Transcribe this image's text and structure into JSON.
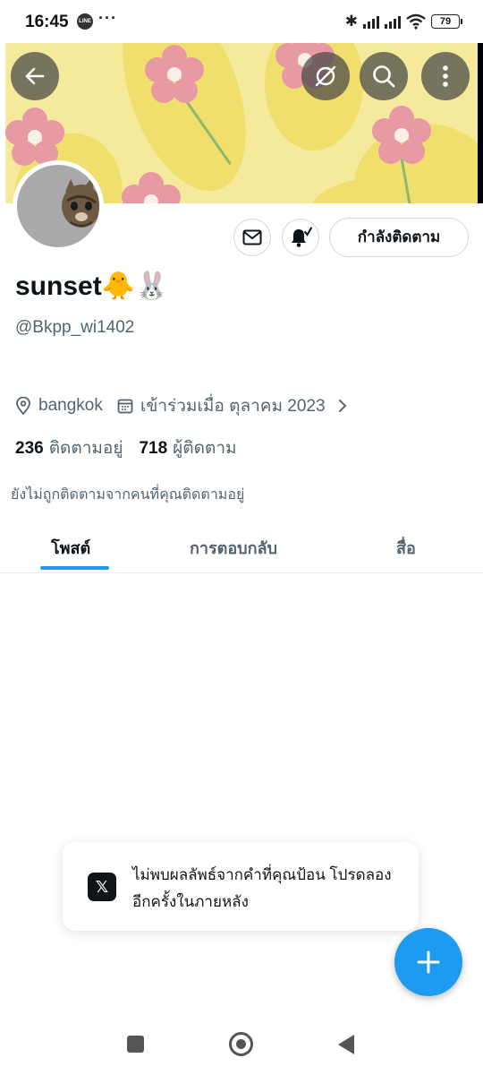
{
  "status_bar": {
    "time": "16:45",
    "line_app_label": "LINE",
    "more": "···",
    "bluetooth": "✱",
    "battery": "79"
  },
  "profile": {
    "name": "sunset🐥🐰",
    "handle": "@Bkpp_wi1402",
    "location": "bangkok",
    "joined": "เข้าร่วมเมื่อ ตุลาคม 2023",
    "following_count": "236",
    "following_label": "ติดตามอยู่",
    "followers_count": "718",
    "followers_label": "ผู้ติดตาม",
    "not_followed_text": "ยังไม่ถูกติดตามจากคนที่คุณติดตามอยู่"
  },
  "actions": {
    "follow_label": "กำลังติดตาม"
  },
  "tabs": [
    {
      "label": "โพสต์",
      "active": true
    },
    {
      "label": "การตอบกลับ",
      "active": false
    },
    {
      "label": "สื่อ",
      "active": false
    }
  ],
  "toast": {
    "icon": "𝕏",
    "message": "ไม่พบผลลัพธ์จากคำที่คุณป้อน โปรดลองอีกครั้งในภายหลัง"
  },
  "colors": {
    "accent": "#1d9bf0",
    "banner_bg": "#f5ea9c",
    "flower": "#e79aa3"
  },
  "icons": [
    "back-arrow-icon",
    "sync-off-icon",
    "search-icon",
    "more-vertical-icon",
    "mail-icon",
    "bell-check-icon",
    "location-pin-icon",
    "calendar-icon",
    "chevron-right-icon",
    "plus-icon"
  ]
}
